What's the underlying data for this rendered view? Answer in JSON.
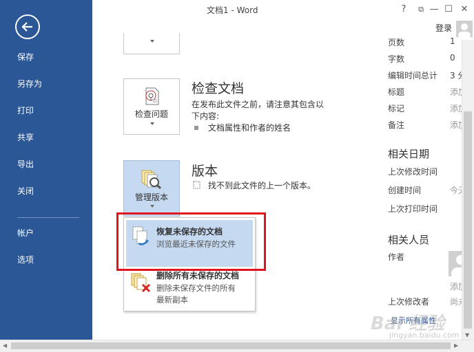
{
  "window": {
    "title": "文档1 - Word",
    "help": "?",
    "restore": "⧉",
    "minimize": "—",
    "maximize": "☐",
    "close": "✕",
    "login": "登录"
  },
  "nav": {
    "items": [
      "保存",
      "另存为",
      "打印",
      "共享",
      "导出",
      "关闭"
    ],
    "items2": [
      "帐户",
      "选项"
    ]
  },
  "inspect": {
    "button_label": "检查问题",
    "title": "检查文档",
    "desc_line1": "在发布此文件之前，请注意其包含以",
    "desc_line2": "下内容:",
    "bullet1": "文档属性和作者的姓名"
  },
  "versions": {
    "button_label": "管理版本",
    "title": "版本",
    "desc": "找不到此文件的上一个版本。"
  },
  "dropdown": {
    "item1_title": "恢复未保存的文档",
    "item1_desc": "浏览最近未保存的文件",
    "item2_title": "删除所有未保存的文档",
    "item2_desc_line1": "删除未保存文件的所有",
    "item2_desc_line2": "最新副本"
  },
  "properties": {
    "rows": [
      {
        "label": "页数",
        "value": "1"
      },
      {
        "label": "字数",
        "value": "0"
      },
      {
        "label": "编辑时间总计",
        "value": "3 分"
      },
      {
        "label": "标题",
        "value": "添加"
      },
      {
        "label": "标记",
        "value": "添加"
      },
      {
        "label": "备注",
        "value": "添加"
      }
    ],
    "dates_head": "相关日期",
    "dates": [
      {
        "label": "上次修改时间",
        "value": ""
      },
      {
        "label": "创建时间",
        "value": "今天"
      },
      {
        "label": "上次打印时间",
        "value": ""
      }
    ],
    "people_head": "相关人员",
    "author_label": "作者",
    "author_value": "添加",
    "last_modified_by_label": "上次修改者",
    "last_modified_by_value": "尚未",
    "show_all": "显示所有属性"
  },
  "watermark": {
    "logo": "Bai 经验",
    "url": "jingyan.baidu.com"
  },
  "colors": {
    "nav_bg": "#2b5797",
    "highlight": "#c5d9f1",
    "annotation_red": "#e0141e"
  }
}
